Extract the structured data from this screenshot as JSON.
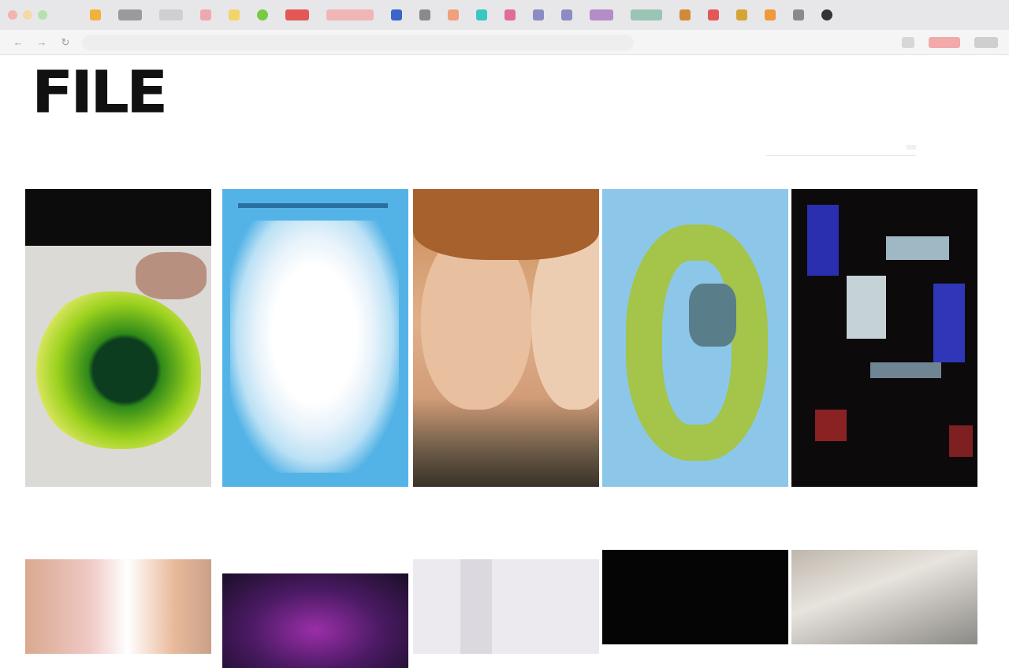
{
  "browser": {
    "tab_favicon_colors": [
      "#f2b23a",
      "#9a9a9a",
      "#cfcfcf",
      "#f0a8b0",
      "#f3d36b",
      "#7ac943",
      "#e45757",
      "#e45757",
      "#3a65c9",
      "#8a8a8a",
      "#f0a07a",
      "#3ac7c1",
      "#e06c9b",
      "#8c8cc4",
      "#8c8cc4",
      "#b48cc8",
      "#8c8cc4",
      "#d08a3a",
      "#e45757",
      "#d4a534",
      "#f0983a",
      "#8a8a8a",
      "#333333"
    ]
  },
  "site": {
    "logo": "FILE",
    "logo_sub": [
      "",
      "",
      "",
      ""
    ]
  },
  "nav": {
    "items": [
      "",
      "",
      "",
      "",
      "",
      "",
      "",
      "",
      ""
    ],
    "search_placeholder": "",
    "search_button": ""
  },
  "cards_row1": [
    {
      "caption": ""
    },
    {
      "caption": ""
    },
    {
      "caption": ""
    },
    {
      "caption": ""
    },
    {
      "caption": ""
    }
  ],
  "cards_row2": [
    {
      "caption": ""
    },
    {
      "caption": ""
    },
    {
      "caption": ""
    },
    {
      "caption": ""
    },
    {
      "caption": ""
    }
  ]
}
